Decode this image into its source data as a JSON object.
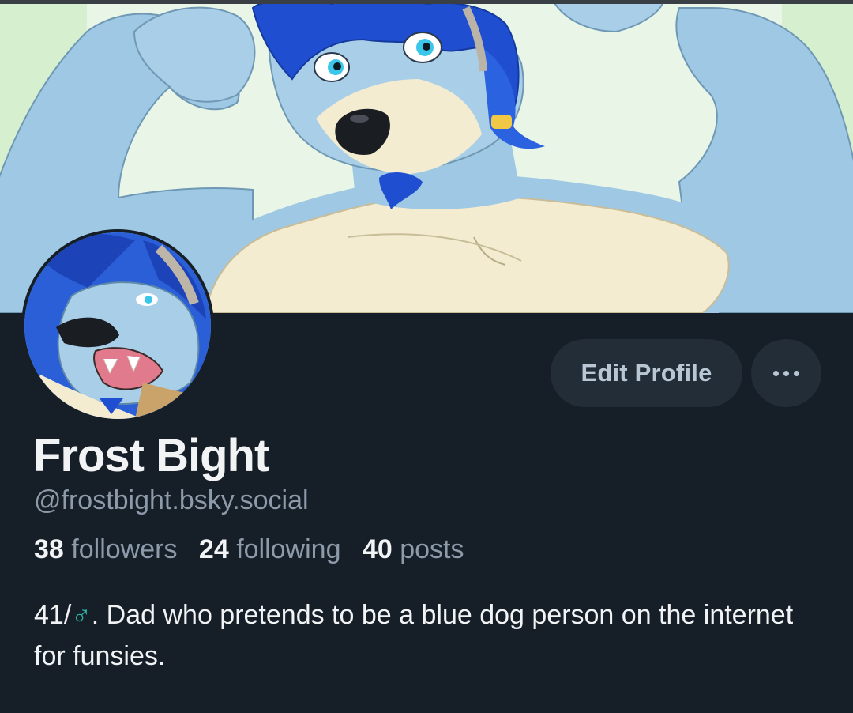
{
  "banner": {
    "image": "blue-wolf-flexing-banner"
  },
  "avatar": {
    "image": "blue-wolf-avatar"
  },
  "actions": {
    "edit_label": "Edit Profile",
    "more_icon": "ellipsis-icon"
  },
  "profile": {
    "display_name": "Frost Bight",
    "handle": "@frostbight.bsky.social",
    "stats": {
      "followers_count": "38",
      "followers_label": "followers",
      "following_count": "24",
      "following_label": "following",
      "posts_count": "40",
      "posts_label": "posts"
    },
    "bio": {
      "prefix": "41/",
      "symbol": "♂",
      "text": ". Dad who pretends to be a blue dog person on the internet for funsies."
    }
  },
  "colors": {
    "background": "#161e27",
    "button_bg": "#222d38",
    "accent_symbol": "#2bb7a9"
  }
}
